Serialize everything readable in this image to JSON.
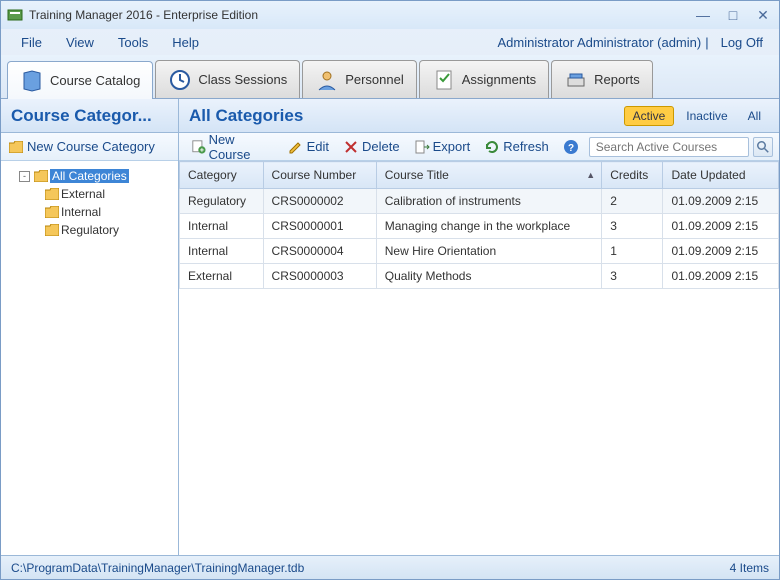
{
  "window": {
    "title": "Training Manager 2016 - Enterprise Edition"
  },
  "menu": {
    "items": [
      "File",
      "View",
      "Tools",
      "Help"
    ]
  },
  "user": {
    "label": "Administrator Administrator (admin)",
    "logoff": "Log Off"
  },
  "tabs": [
    {
      "label": "Course Catalog",
      "icon": "catalog-icon",
      "active": true
    },
    {
      "label": "Class Sessions",
      "icon": "sessions-icon"
    },
    {
      "label": "Personnel",
      "icon": "personnel-icon"
    },
    {
      "label": "Assignments",
      "icon": "assignments-icon"
    },
    {
      "label": "Reports",
      "icon": "reports-icon"
    }
  ],
  "left": {
    "heading": "Course Categor...",
    "new_cat": "New Course Category",
    "tree": {
      "root": "All Categories",
      "children": [
        "External",
        "Internal",
        "Regulatory"
      ]
    }
  },
  "right": {
    "heading": "All Categories",
    "filters": {
      "active": "Active",
      "inactive": "Inactive",
      "all": "All"
    },
    "toolbar": {
      "new_course": "New Course",
      "edit": "Edit",
      "delete": "Delete",
      "export": "Export",
      "refresh": "Refresh"
    },
    "search_placeholder": "Search Active Courses",
    "columns": [
      "Category",
      "Course Number",
      "Course Title",
      "Credits",
      "Date Updated"
    ],
    "sort_col": "Course Title",
    "rows": [
      {
        "category": "Regulatory",
        "number": "CRS0000002",
        "title": "Calibration of instruments",
        "credits": "2",
        "updated": "01.09.2009 2:15"
      },
      {
        "category": "Internal",
        "number": "CRS0000001",
        "title": "Managing change in the workplace",
        "credits": "3",
        "updated": "01.09.2009 2:15"
      },
      {
        "category": "Internal",
        "number": "CRS0000004",
        "title": "New Hire Orientation",
        "credits": "1",
        "updated": "01.09.2009 2:15"
      },
      {
        "category": "External",
        "number": "CRS0000003",
        "title": "Quality Methods",
        "credits": "3",
        "updated": "01.09.2009 2:15"
      }
    ]
  },
  "status": {
    "path": "C:\\ProgramData\\TrainingManager\\TrainingManager.tdb",
    "count": "4 Items"
  }
}
